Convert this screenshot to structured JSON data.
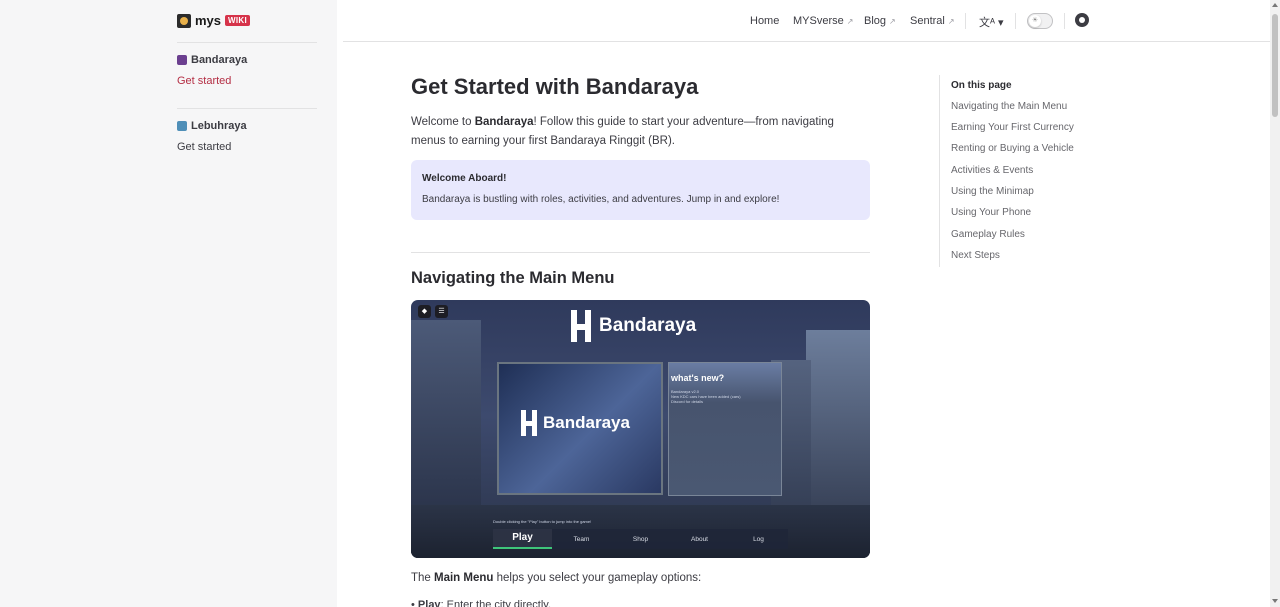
{
  "brand": {
    "name": "mys",
    "badge": "WIKI"
  },
  "sidebar": {
    "groups": [
      {
        "title": "Bandaraya",
        "items": [
          {
            "label": "Get started",
            "active": true
          }
        ]
      },
      {
        "title": "Lebuhraya",
        "items": [
          {
            "label": "Get started",
            "active": false
          }
        ]
      }
    ]
  },
  "header": {
    "nav": [
      {
        "label": "Home",
        "external": false
      },
      {
        "label": "MYSverse",
        "external": true
      },
      {
        "label": "Blog",
        "external": true
      },
      {
        "label": "Sentral",
        "external": true
      }
    ],
    "icons": {
      "language": "translate-icon",
      "theme": "sun-icon",
      "github": "github-icon"
    }
  },
  "content": {
    "title": "Get Started with Bandaraya",
    "intro_before": "Welcome to ",
    "intro_bold": "Bandaraya",
    "intro_after": "! Follow this guide to start your adventure—from navigating menus to earning your first Bandaraya Ringgit (BR).",
    "callout": {
      "title": "Welcome Aboard!",
      "text": "Bandaraya is bustling with roles, activities, and adventures. Jump in and explore!"
    },
    "section_title": "Navigating the Main Menu",
    "screenshot": {
      "brand": "Bandaraya",
      "panel_brand": "Bandaraya",
      "news_title": "what's new?",
      "news_lines": [
        "Bandaraya v2.0",
        "New KDC cars have been added (cars)",
        "Discord for details"
      ],
      "hint": "Double clicking the \"Play\" button to jump into the game!",
      "menu": [
        "Play",
        "Team",
        "Shop",
        "About",
        "Log"
      ]
    },
    "para_before": "The ",
    "para_bold": "Main Menu",
    "para_after": " helps you select your gameplay options:",
    "bullet_bold": "Play",
    "bullet_text": ": Enter the city directly."
  },
  "toc": {
    "title": "On this page",
    "items": [
      "Navigating the Main Menu",
      "Earning Your First Currency",
      "Renting or Buying a Vehicle",
      "Activities & Events",
      "Using the Minimap",
      "Using Your Phone",
      "Gameplay Rules",
      "Next Steps"
    ]
  },
  "colors": {
    "accent": "#b42e44",
    "callout_bg": "#e8e8fd",
    "sidebar_bg": "#f6f6f7"
  }
}
